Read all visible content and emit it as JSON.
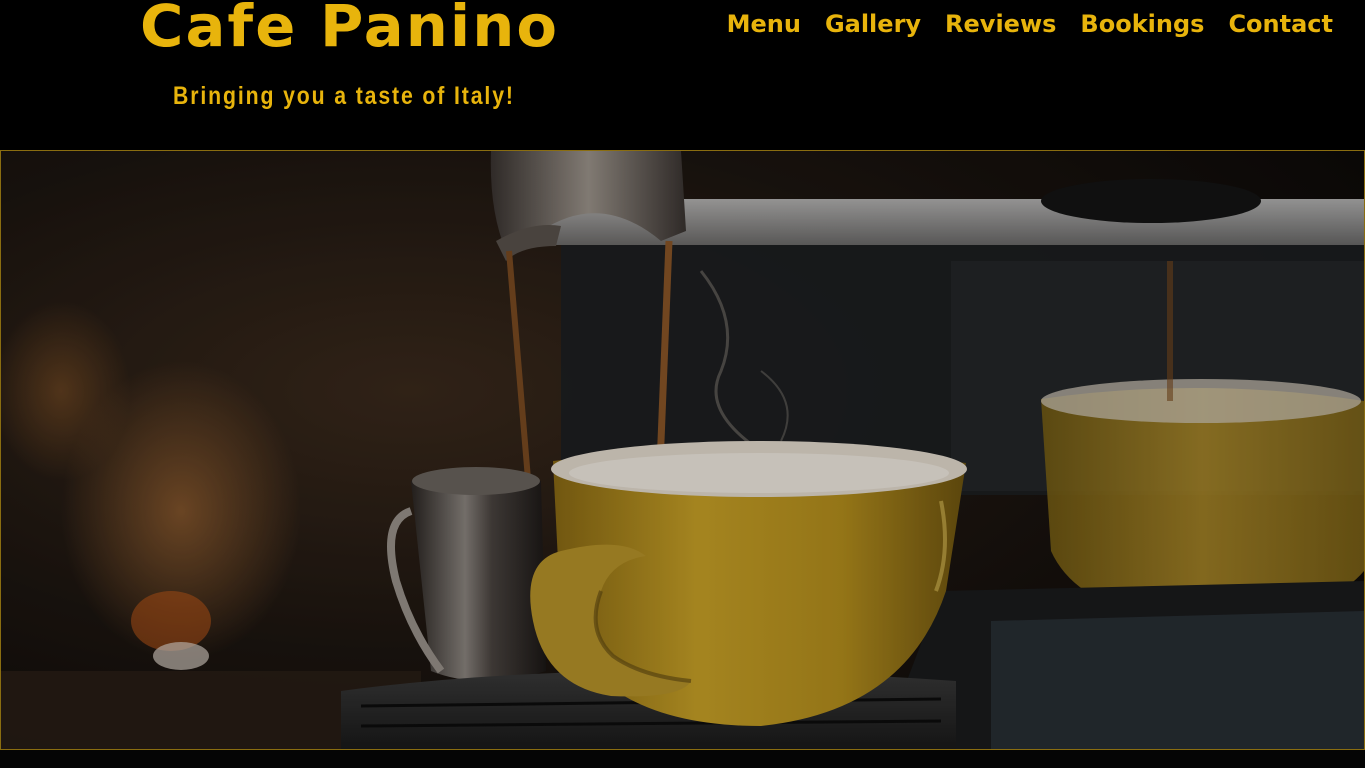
{
  "site": {
    "title": "Cafe Panino",
    "tagline": "Bringing you a taste of Italy!"
  },
  "nav": {
    "items": [
      {
        "label": "Menu"
      },
      {
        "label": "Gallery"
      },
      {
        "label": "Reviews"
      },
      {
        "label": "Bookings"
      },
      {
        "label": "Contact"
      }
    ]
  },
  "colors": {
    "accent": "#e8b40c",
    "background": "#000000"
  }
}
